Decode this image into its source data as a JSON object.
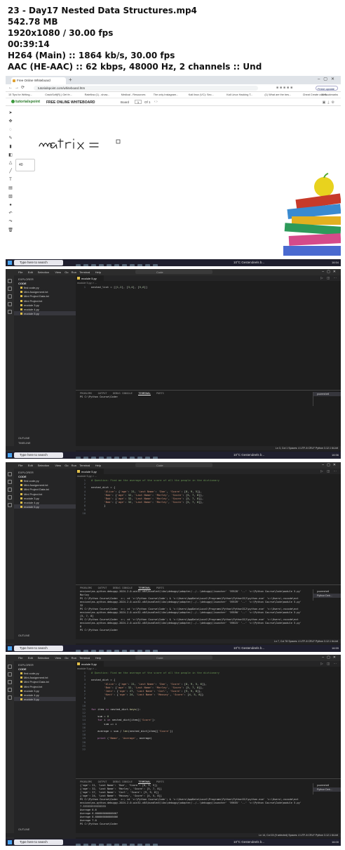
{
  "header": {
    "title": "23 - Day17 Nested Data Structures.mp4",
    "size": "542.78 MB",
    "resolution": "1920x1080 / 30.00 fps",
    "duration": "00:39:14",
    "video": "H264 (Main) :: 1864 kb/s, 30.00 fps",
    "audio": "AAC (HE-AAC) :: 62 kbps, 48000 Hz, 2 channels :: Und"
  },
  "browser": {
    "tab_title": "Free Online Whiteboard",
    "url": "tutorialspoint.com/whiteboard.htm",
    "update_label": "Finish update",
    "bookmarks": [
      "15 Tips for Writing...",
      "CrackSoft(R) | Get fe...",
      "Rateflow (1) - show...",
      "Medical - Resources",
      "The only Instagram...",
      "Kali linux (VC): Sec...",
      "Kali Linux Hacking T...",
      "(1) What are the bes...",
      "Cheat Create a New..."
    ],
    "all_bookmarks": "All Bookmarks",
    "logo": "tutorialspoint",
    "brand": "FREE ONLINE WHITEBOARD",
    "board_label": "Board",
    "page_value": "1",
    "page_of": "Of 1",
    "size_value": "40",
    "handwriting": "matrix ="
  },
  "taskbar": {
    "search": "Type here to search",
    "weather": "10°C  Gestendeels b...",
    "tray_lang": "ENG",
    "clock": [
      "16:54",
      "16:56",
      "16:59",
      "16:00"
    ],
    "date": "28/01/2024"
  },
  "vscode": {
    "menu": [
      "File",
      "Edit",
      "Selection",
      "View",
      "Go",
      "Run",
      "Terminal",
      "Help"
    ],
    "command": "Code",
    "explorer": "EXPLORER",
    "folder": "CODE",
    "files_a": [
      "first code.py",
      "Mini Assignment.txt",
      "Mini Project Data.txt",
      "Mini Project.txt",
      "module 3.py",
      "module 4.py",
      "module 5.py"
    ],
    "outline": "OUTLINE",
    "timeline": "TIMELINE",
    "tab": "module 5.py",
    "crumb": "module 5.py > ...",
    "terminal_tabs": [
      "PROBLEMS",
      "OUTPUT",
      "DEBUG CONSOLE",
      "TERMINAL",
      "PORTS"
    ],
    "shells": [
      "powershell",
      "Python Deb..."
    ],
    "panel2": {
      "code": [
        "nested_list = [[1,2], [3,4], [5,6]]"
      ],
      "terminal": [
        "PS C:\\Python Course\\Code>"
      ],
      "status": "Ln 3, Col 1   Spaces: 4   UTF-8   CRLF   Python   3.12.1 64-bit"
    },
    "panel3": {
      "code": [
        "# Question: Find me the average of the score of all the people in the dictionary",
        "",
        "nested_dict = {",
        "        'Alice': {'age': 21, 'Last Name': 'Doe', 'Score': [8, 9, 5]},",
        "        'Bob': {'age': 32, 'Last Name': 'Marley', 'Score': [5, 7, 8]},",
        "        'Bob': {'age': 32, 'Last Name': 'Marley', 'Score': [5, 7, 8]},",
        "        'Bob': {'age': 32, 'Last Name': 'Marley', 'Score': [5, 7, 8]},",
        "        }",
        "",
        ""
      ],
      "terminal": [
        "ensions\\ms-python.debugpy-2024.2.0-win32-x64\\bundled\\libs\\debugpy\\adapter/../..\\debugpy\\launcher' '59528' '--' 'c:\\Python Course\\Code\\module 5.py'",
        "Marley",
        "PS C:\\Python Course\\Code>  c:; cd 'c:\\Python Course\\Code'; & 'c:\\Users\\AppData\\Local\\Programs\\Python\\Python312\\python.exe' 'c:\\Users\\.vscode\\ext",
        "ensions\\ms-python.debugpy-2024.2.0-win32-x64\\bundled\\libs\\debugpy\\adapter/../..\\debugpy\\launcher' '59539' '--' 'c:\\Python Course\\Code\\module 5.py'",
        "32",
        "PS C:\\Python Course\\Code>  c:; cd 'c:\\Python Course\\Code'; & 'c:\\Users\\AppData\\Local\\Programs\\Python\\Python312\\python.exe' 'c:\\Users\\.vscode\\ext",
        "ensions\\ms-python.debugpy-2024.2.0-win32-x64\\bundled\\libs\\debugpy\\adapter/../..\\debugpy\\launcher' '59590' '--' 'c:\\Python Course\\Code\\module 5.py'",
        "[5, 7, 8]",
        "PS C:\\Python Course\\Code>  c:; cd 'c:\\Python Course\\Code'; & 'c:\\Users\\AppData\\Local\\Programs\\Python\\Python312\\python.exe' 'c:\\Users\\.vscode\\ext",
        "ensions\\ms-python.debugpy-2024.2.0-win32-x64\\bundled\\libs\\debugpy\\adapter/../..\\debugpy\\launcher' '59615' '--' 'c:\\Python Course\\Code\\module 5.py'",
        "8",
        "PS C:\\Python Course\\Code>"
      ],
      "status": "Ln 7, Col 78   Spaces: 4   UTF-8   CRLF   Python   3.12.1 64-bit"
    },
    "panel4": {
      "code": [
        "# Question: Find me the average of the score of all the people in the dictionary",
        "",
        "nested_dict = {",
        "        'Alice': {'age': 21, 'Last Name': 'Doe', 'Score': [8, 9, 5, 6]},",
        "        'Bob': {'age': 32, 'Last Name': 'Marley', 'Score': [5, 7, 8]},",
        "        'John': {'age': 27, 'Last Name': 'Carl', 'Score': [9, 9, 8]},",
        "        'Kent': {'age': 24, 'Last Name': 'Massey', 'Score': [4, 5, 8]}",
        "        }",
        "",
        "",
        "for item in nested_dict.keys():",
        "",
        "    sum = 0",
        "    for i in nested_dict[item]['Score']:",
        "        sum += i",
        "",
        "    average = sum / len(nested_dict[item]['Score'])",
        "",
        "    print ('Name', 'Average', average)",
        "",
        "",
        ""
      ],
      "terminal": [
        "{'age': 21, 'Last Name': 'Doe', 'Score': [8, 9, 5]}",
        "{'age': 32, 'Last Name': 'Marley', 'Score': [5, 7, 8]}",
        "{'age': 27, 'Last Name': 'Carl', 'Score': [9, 9, 8]}",
        "{'age': 24, 'Last Name': 'Massey', 'Score': [4, 5, 8]}",
        "PS C:\\Python Course\\Code>  c:; cd 'c:\\Python Course\\Code'; & 'c:\\Users\\AppData\\Local\\Programs\\Python\\Python312\\python.exe' 'c:\\Users\\.vscode\\ext",
        "ensions\\ms-python.debugpy-2024.2.0-win32-x64\\bundled\\libs\\debugpy\\adapter/../..\\debugpy\\launcher' '59655' '--' 'c:\\Python Course\\Code\\module 5.py'",
        "7.333333333333333",
        "Average 6.6",
        "Average 6.666666666666667",
        "Average 8.666666666666666",
        "Average 7.0",
        "PS C:\\Python Course\\Code>"
      ],
      "status": "Ln 14, Col 15 (9 selected)   Spaces: 4   UTF-8   CRLF   Python   3.12.1 64-bit"
    }
  }
}
